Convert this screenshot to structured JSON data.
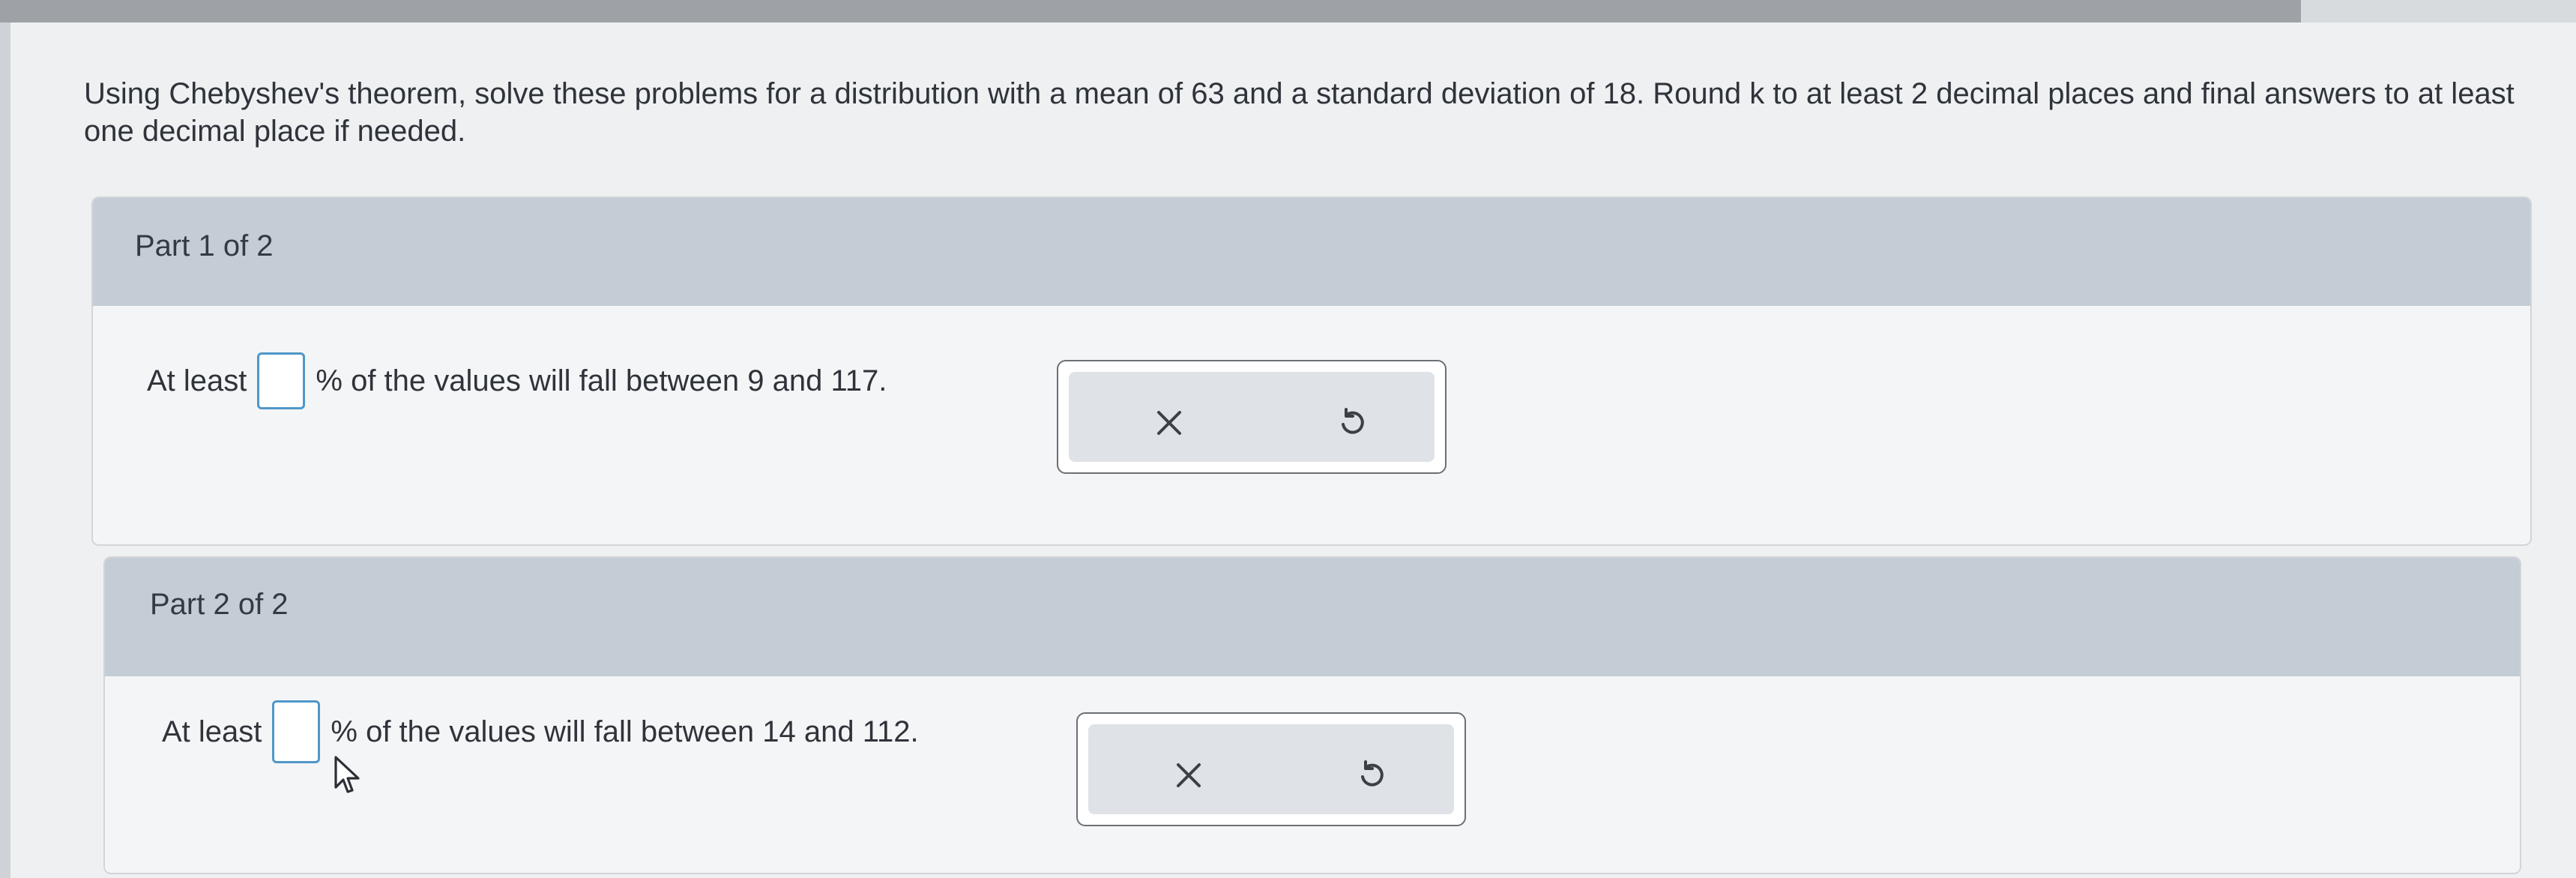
{
  "problem": {
    "instructions": "Using Chebyshev's theorem, solve these problems for a distribution with a mean of 63 and a standard deviation of 18. Round k to at least 2 decimal places and final answers to at least one decimal place if needed."
  },
  "parts": [
    {
      "title": "Part 1 of 2",
      "prefix": "At least",
      "answer_value": "",
      "suffix": "% of the values will fall between 9 and 117."
    },
    {
      "title": "Part 2 of 2",
      "prefix": "At least",
      "answer_value": "",
      "suffix": "% of the values will fall between 14 and 112."
    }
  ],
  "actions": {
    "clear_icon": "x-icon",
    "reset_icon": "undo-icon"
  },
  "colors": {
    "header_band": "#c4cdd5",
    "input_border": "#4f97c9",
    "action_panel": "#dfe3e7"
  }
}
